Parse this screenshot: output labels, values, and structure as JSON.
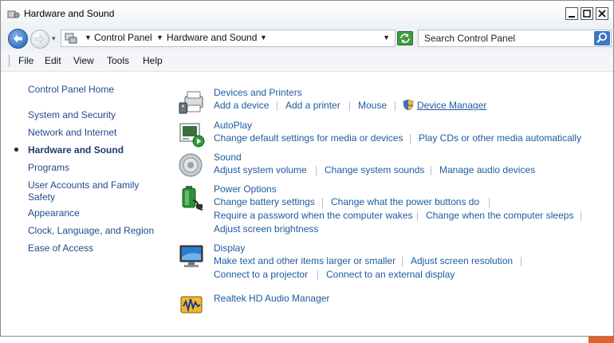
{
  "window": {
    "title": "Hardware and Sound"
  },
  "address": {
    "crumbs": [
      "Control Panel",
      "Hardware and Sound"
    ],
    "search_placeholder": "Search Control Panel"
  },
  "menu": [
    "File",
    "Edit",
    "View",
    "Tools",
    "Help"
  ],
  "left_nav": {
    "home": "Control Panel Home",
    "items": [
      {
        "label": "System and Security",
        "active": false
      },
      {
        "label": "Network and Internet",
        "active": false
      },
      {
        "label": "Hardware and Sound",
        "active": true
      },
      {
        "label": "Programs",
        "active": false
      },
      {
        "label": "User Accounts and Family Safety",
        "active": false
      },
      {
        "label": "Appearance",
        "active": false
      },
      {
        "label": "Clock, Language, and Region",
        "active": false
      },
      {
        "label": "Ease of Access",
        "active": false
      }
    ]
  },
  "categories": {
    "devices": {
      "title": "Devices and Printers",
      "links": [
        "Add a device",
        "Add a printer",
        "Mouse",
        "Device Manager"
      ]
    },
    "autoplay": {
      "title": "AutoPlay",
      "links": [
        "Change default settings for media or devices",
        "Play CDs or other media automatically"
      ]
    },
    "sound": {
      "title": "Sound",
      "links": [
        "Adjust system volume",
        "Change system sounds",
        "Manage audio devices"
      ]
    },
    "power": {
      "title": "Power Options",
      "links": [
        "Change battery settings",
        "Change what the power buttons do",
        "Require a password when the computer wakes",
        "Change when the computer sleeps",
        "Adjust screen brightness"
      ]
    },
    "display": {
      "title": "Display",
      "links": [
        "Make text and other items larger or smaller",
        "Adjust screen resolution",
        "Connect to a projector",
        "Connect to an external display"
      ]
    },
    "realtek": {
      "title": "Realtek HD Audio Manager"
    }
  }
}
